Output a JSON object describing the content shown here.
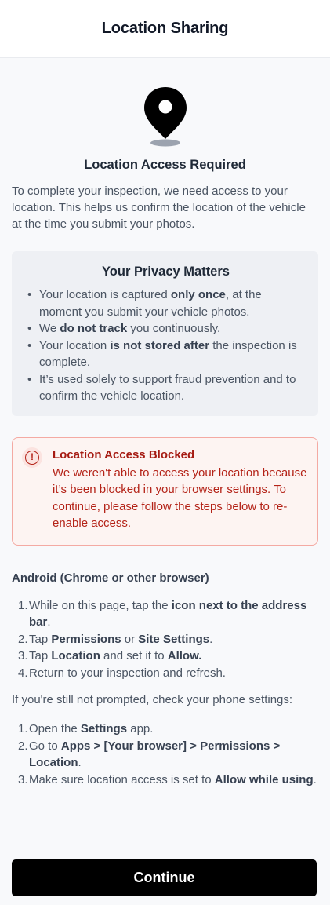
{
  "header": {
    "title": "Location Sharing"
  },
  "hero": {
    "icon": "map-pin-icon",
    "title": "Location Access Required",
    "intro": "To complete your inspection, we need access to your location. This helps us confirm the location of the vehicle at the time you submit your photos."
  },
  "privacy": {
    "title": "Your Privacy Matters",
    "items": [
      {
        "a": "Your location is captured ",
        "b": "only once",
        "c": ", at the moment you submit your vehicle photos."
      },
      {
        "a": "We ",
        "b": "do not track",
        "c": " you continuously."
      },
      {
        "a": "Your location ",
        "b": "is not stored after",
        "c": " the inspection is complete."
      },
      {
        "a": "It’s used solely to support fraud prevention and to confirm the vehicle location.",
        "b": "",
        "c": ""
      }
    ]
  },
  "alert": {
    "icon": "alert-circle-icon",
    "title": "Location Access Blocked",
    "message": "We weren't able to access your location because it’s been blocked in your browser settings. To continue, please follow the steps below to re-enable access.",
    "colors": {
      "border": "#f4aaa3",
      "text": "#b42318",
      "background": "#fdf4f2"
    }
  },
  "android": {
    "title": "Android (Chrome or other browser)",
    "steps": [
      {
        "num": "1.",
        "a": "While on this page, tap the ",
        "b": "icon next to the address bar",
        "c": ".",
        "d": "",
        "e": ""
      },
      {
        "num": "2.",
        "a": "Tap ",
        "b": "Permissions",
        "c": " or ",
        "d": "Site Settings",
        "e": "."
      },
      {
        "num": "3.",
        "a": "Tap ",
        "b": "Location",
        "c": " and set it to ",
        "d": "Allow.",
        "e": ""
      },
      {
        "num": "4.",
        "a": "Return to your inspection and refresh.",
        "b": "",
        "c": "",
        "d": "",
        "e": ""
      }
    ]
  },
  "phone": {
    "intro": "If you're still not prompted, check your phone settings:",
    "steps": [
      {
        "num": "1.",
        "a": "Open the ",
        "b": "Settings",
        "c": " app."
      },
      {
        "num": "2.",
        "a": "Go to ",
        "b": "Apps > [Your browser] > Permissions > Location",
        "c": "."
      },
      {
        "num": "3.",
        "a": "Make sure location access is set to ",
        "b": "Allow while using",
        "c": "."
      }
    ]
  },
  "footer": {
    "continue_label": "Continue"
  }
}
